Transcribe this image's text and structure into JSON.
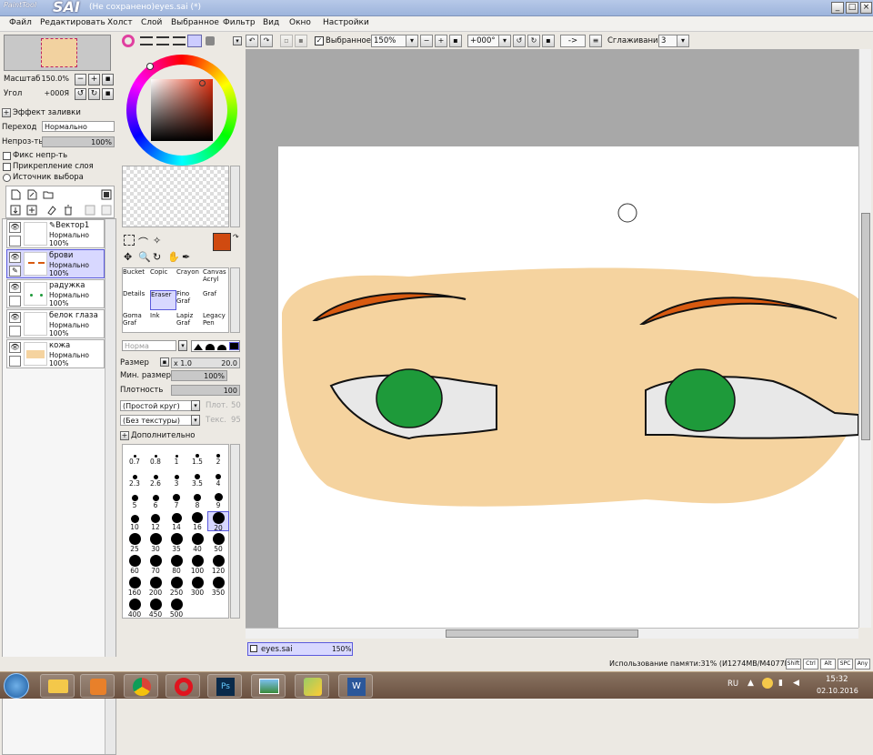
{
  "app": {
    "logo_small": "PaintTool",
    "logo_big": "SAI",
    "window_title": "(Не сохранено)eyes.sai (*)"
  },
  "menu": [
    "Файл",
    "Редактировать",
    "Холст",
    "Слой",
    "Выбранное",
    "Фильтр",
    "Вид",
    "Окно",
    "Настройки"
  ],
  "toolbar": {
    "selected_label": "Выбранное",
    "zoom_value": "150%",
    "angle_value": "+000°",
    "flip_label": "->",
    "smoothing_label": "Сглаживание",
    "smoothing_value": "3"
  },
  "navigator": {
    "scale_label": "Масштаб",
    "scale_value": "150.0%",
    "angle_label": "Угол",
    "angle_value": "+000Я"
  },
  "layer_options": {
    "fill_effect_label": "Эффект заливки",
    "blend_label": "Переход",
    "blend_value": "Нормально",
    "opacity_label": "Непроз-ть",
    "opacity_value": "100%",
    "preserve_opacity": "Фикс непр-ть",
    "clipping": "Прикрепление слоя",
    "selection_source": "Источник выбора"
  },
  "layers": [
    {
      "name": "Вектор1",
      "mode": "Нормально",
      "opacity": "100%"
    },
    {
      "name": "брови",
      "mode": "Нормально",
      "opacity": "100%"
    },
    {
      "name": "радужка",
      "mode": "Нормально",
      "opacity": "100%"
    },
    {
      "name": "белок глаза",
      "mode": "Нормально",
      "opacity": "100%"
    },
    {
      "name": "кожа",
      "mode": "Нормально",
      "opacity": "100%"
    }
  ],
  "colors": {
    "primary": "#d04a10",
    "secondary": "#ffffff",
    "skin": "#f5d39f",
    "brow": "#d85a10",
    "iris": "#1e9a3a",
    "selection": "#5a5adc"
  },
  "tools": [
    [
      "Bucket",
      "Copic",
      "Crayon",
      "Canvas Acryl"
    ],
    [
      "Details",
      "Eraser",
      "Fino Graf",
      "Graf"
    ],
    [
      "Goma Graf",
      "Ink",
      "Lapiz Graf",
      "Legacy Pen"
    ]
  ],
  "brush": {
    "mode_placeholder": "Норма",
    "size_label": "Размер",
    "size_mult": "x 1.0",
    "size_value": "20.0",
    "min_size_label": "Мин. размер",
    "min_size_value": "100%",
    "density_label": "Плотность",
    "density_value": "100",
    "shape_value": "(Простой круг)",
    "shape_strength_label": "Плот.",
    "shape_strength_value": "50",
    "texture_value": "(Без текстуры)",
    "texture_strength_label": "Текс.",
    "texture_strength_value": "95",
    "advanced_label": "Дополнительно"
  },
  "brush_sizes": [
    "0.7",
    "0.8",
    "1",
    "1.5",
    "2",
    "2.3",
    "2.6",
    "3",
    "3.5",
    "4",
    "5",
    "6",
    "7",
    "8",
    "9",
    "10",
    "12",
    "14",
    "16",
    "20",
    "25",
    "30",
    "35",
    "40",
    "50",
    "60",
    "70",
    "80",
    "100",
    "120",
    "160",
    "200",
    "250",
    "300",
    "350",
    "400",
    "450",
    "500"
  ],
  "document_tab": {
    "name": "eyes.sai",
    "zoom": "150%"
  },
  "status": {
    "memory": "Использование памяти:31% (И1274MB/M4077MB)",
    "keys": [
      "Shift",
      "Ctrl",
      "Alt",
      "SPC",
      "Any"
    ]
  },
  "taskbar": {
    "lang": "RU",
    "time": "15:32",
    "date": "02.10.2016"
  }
}
